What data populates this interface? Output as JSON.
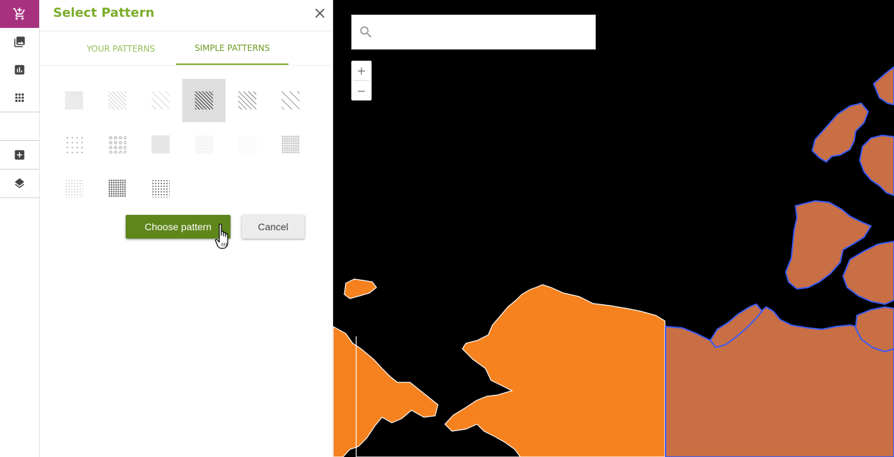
{
  "rail": {
    "items": [
      {
        "icon": "add-shopping-cart-icon"
      },
      {
        "icon": "image-icon"
      },
      {
        "icon": "bar-chart-icon"
      },
      {
        "icon": "grid-icon"
      },
      {
        "icon": "add-box-icon"
      },
      {
        "icon": "layers-icon"
      }
    ],
    "accent": "#a8317e"
  },
  "panel": {
    "title": "Select Pattern",
    "tabs": [
      {
        "label": "YOUR PATTERNS",
        "active": false
      },
      {
        "label": "SIMPLE PATTERNS",
        "active": true
      }
    ],
    "patterns": [
      {
        "name": "diagonal-fine"
      },
      {
        "name": "diagonal-medium"
      },
      {
        "name": "diagonal-sparse"
      },
      {
        "name": "diagonal-heavy",
        "selected": true
      },
      {
        "name": "diagonal-bold"
      },
      {
        "name": "diagonal-wide"
      },
      {
        "name": "dots-sparse"
      },
      {
        "name": "dots-medium"
      },
      {
        "name": "solid-light"
      },
      {
        "name": "dots-fine"
      },
      {
        "name": "dots-very-fine"
      },
      {
        "name": "dots-dense"
      },
      {
        "name": "dots-grid"
      },
      {
        "name": "dots-heavy"
      },
      {
        "name": "dots-large"
      }
    ],
    "choose_label": "Choose pattern",
    "cancel_label": "Cancel",
    "accent": "#7bad2c",
    "button_color": "#5e861b"
  },
  "map": {
    "search_placeholder": "",
    "zoom_in": "+",
    "zoom_out": "−",
    "land_color": "#f5821f",
    "land_muted_color": "#c96f45",
    "outline_color": "#3a5cf5"
  }
}
